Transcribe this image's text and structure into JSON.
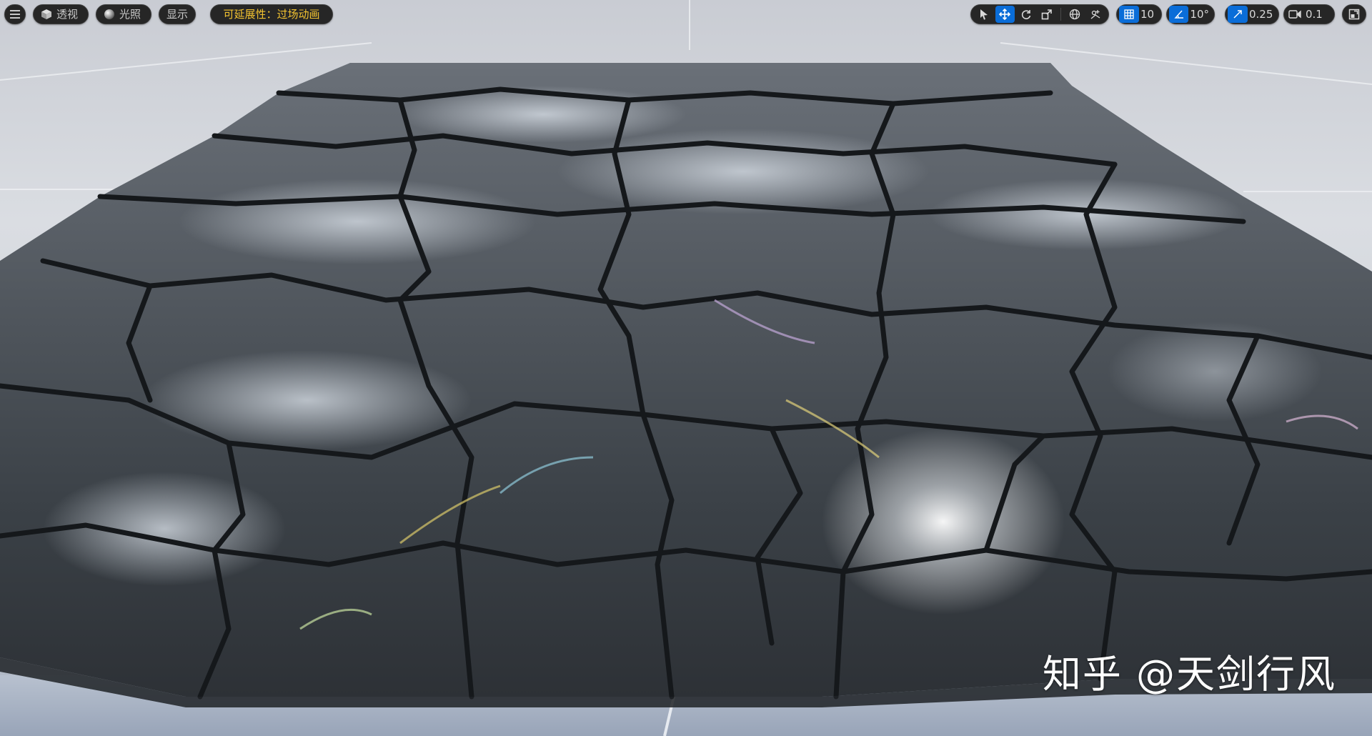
{
  "toolbar_left": {
    "view_mode_label": "透视",
    "lighting_label": "光照",
    "show_label": "显示",
    "scalability_label": "可延展性：过场动画"
  },
  "toolbar_right": {
    "grid_snap_value": "10",
    "rotation_snap_value": "10°",
    "scale_snap_value": "0.25",
    "camera_speed_value": "0.1",
    "active_tool": "translate"
  },
  "icons": {
    "menu": "hamburger-menu-icon",
    "view_mode": "perspective-cube-icon",
    "lighting": "lit-sphere-icon",
    "select": "select-arrow-icon",
    "translate": "translate-arrows-icon",
    "rotate": "rotate-icon",
    "scale": "scale-icon",
    "world": "world-globe-icon",
    "surface_snap": "surface-snap-icon",
    "grid_snap": "grid-snap-icon",
    "rotation_snap": "angle-snap-icon",
    "scale_snap": "scale-snap-icon",
    "camera": "camera-speed-icon",
    "maximize": "maximize-viewport-icon"
  },
  "colors": {
    "toolbar_bg": "#262626",
    "active_blue": "#0a6dd8",
    "scalability_text": "#f4c430",
    "floor_grey": "#c9ccd3",
    "rock_dark": "#3a3f45"
  },
  "watermark": {
    "text": "知乎 @天剑行风"
  }
}
